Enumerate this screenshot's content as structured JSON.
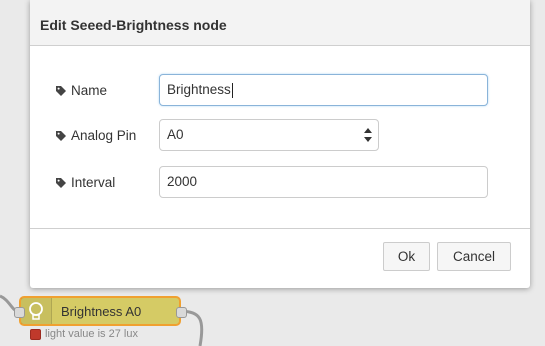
{
  "dialog": {
    "title": "Edit Seeed-Brightness node",
    "fields": {
      "name": {
        "label": "Name",
        "value": "Brightness",
        "icon": "tag-icon"
      },
      "pin": {
        "label": "Analog Pin",
        "value": "A0",
        "icon": "tag-icon"
      },
      "interval": {
        "label": "Interval",
        "value": "2000",
        "icon": "tag-icon"
      }
    },
    "buttons": {
      "ok": "Ok",
      "cancel": "Cancel"
    }
  },
  "node": {
    "label": "Brightness A0",
    "icon": "lightbulb-icon",
    "fill": "#d5cb65",
    "border": "#f0a030",
    "status": {
      "text": "light value is 27 lux",
      "color": "#c0392b"
    }
  }
}
